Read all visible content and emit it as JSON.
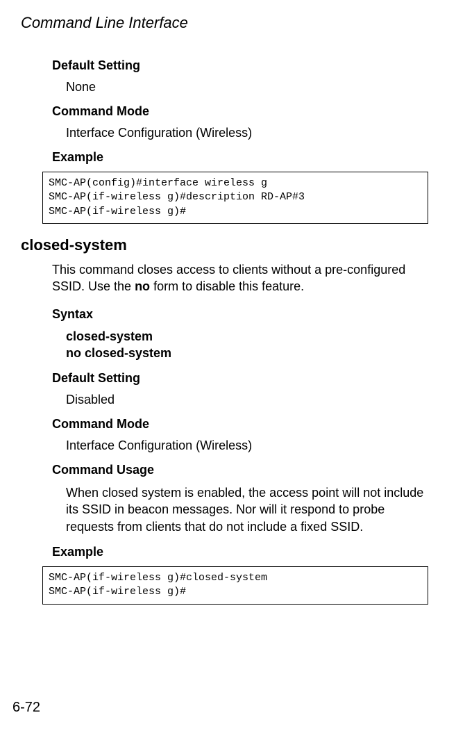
{
  "header": {
    "title": "Command Line Interface"
  },
  "section1": {
    "defaultSettingLabel": "Default Setting",
    "defaultSettingValue": "None",
    "commandModeLabel": "Command Mode",
    "commandModeValue": "Interface Configuration (Wireless)",
    "exampleLabel": "Example",
    "exampleCode": "SMC-AP(config)#interface wireless g\nSMC-AP(if-wireless g)#description RD-AP#3\nSMC-AP(if-wireless g)#"
  },
  "command": {
    "name": "closed-system",
    "descriptionPart1": "This command closes access to clients without a pre-configured SSID. Use the ",
    "descriptionBold": "no",
    "descriptionPart2": " form to disable this feature.",
    "syntaxLabel": "Syntax",
    "syntaxLine1": "closed-system",
    "syntaxLine2": "no closed-system",
    "defaultSettingLabel": "Default Setting",
    "defaultSettingValue": "Disabled",
    "commandModeLabel": "Command Mode",
    "commandModeValue": "Interface Configuration (Wireless)",
    "commandUsageLabel": "Command Usage",
    "commandUsageText": "When closed system is enabled, the access point will not include its SSID in beacon messages. Nor will it respond to probe requests from clients that do not include a fixed SSID.",
    "exampleLabel": "Example",
    "exampleCode": "SMC-AP(if-wireless g)#closed-system\nSMC-AP(if-wireless g)#"
  },
  "pageNumber": "6-72"
}
